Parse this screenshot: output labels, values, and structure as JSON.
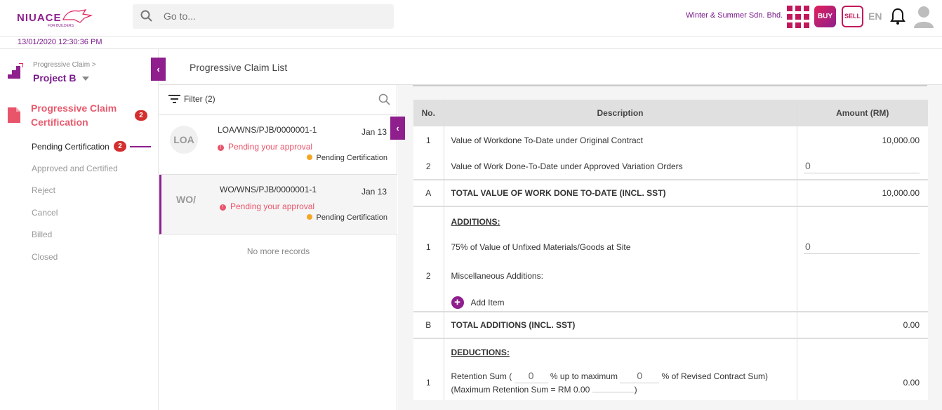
{
  "header": {
    "logo_text": "NIUACE",
    "logo_sub": "FOR BUILDERS",
    "search_placeholder": "Go to...",
    "company": "Winter & Summer Sdn. Bhd.",
    "buy_label": "BUY",
    "sell_label": "SELL",
    "language": "EN",
    "datetime": "13/01/2020 12:30:36 PM"
  },
  "sidebar": {
    "breadcrumb": "Progressive Claim >",
    "project": "Project B",
    "section_title": "Progressive Claim Certification",
    "section_count": "2",
    "items": [
      {
        "label": "Pending Certification",
        "count": "2"
      },
      {
        "label": "Approved and Certified"
      },
      {
        "label": "Reject"
      },
      {
        "label": "Cancel"
      },
      {
        "label": "Billed"
      },
      {
        "label": "Closed"
      }
    ]
  },
  "list": {
    "title": "Progressive Claim List",
    "filter_label": "Filter (2)",
    "cards": [
      {
        "avatar": "LOA",
        "ref": "LOA/WNS/PJB/0000001-1",
        "date": "Jan 13",
        "pending": "Pending your approval",
        "status": "Pending Certification"
      },
      {
        "avatar": "WO/",
        "ref": "WO/WNS/PJB/0000001-1",
        "date": "Jan 13",
        "pending": "Pending your approval",
        "status": "Pending Certification"
      }
    ],
    "no_more": "No more records"
  },
  "claim_table": {
    "headers": {
      "no": "No.",
      "description": "Description",
      "amount": "Amount (RM)"
    },
    "rows": {
      "r1_no": "1",
      "r1_desc": "Value of Workdone To-Date under Original Contract",
      "r1_amt": "10,000.00",
      "r2_no": "2",
      "r2_desc": "Value of Work Done-To-Date under Approved Variation Orders",
      "r2_amt": "0",
      "rA_no": "A",
      "rA_desc": "TOTAL VALUE OF WORK DONE TO-DATE (INCL. SST)",
      "rA_amt": "10,000.00",
      "additions_title": "ADDITIONS:",
      "ad1_no": "1",
      "ad1_desc": "75% of Value of Unfixed Materials/Goods at Site",
      "ad1_amt": "0",
      "ad2_no": "2",
      "ad2_desc": "Miscellaneous Additions:",
      "add_item": "Add Item",
      "rB_no": "B",
      "rB_desc": "TOTAL ADDITIONS (INCL. SST)",
      "rB_amt": "0.00",
      "deductions_title": "DEDUCTIONS:",
      "de1_no": "1",
      "de1_pre": "Retention Sum (",
      "de1_pct": "0",
      "de1_mid": "% up to maximum",
      "de1_max": "0",
      "de1_post": "% of Revised Contract Sum)",
      "de1_line2": "(Maximum Retention Sum = RM 0.00",
      "de1_line2_end": ")",
      "de1_amt": "0.00"
    }
  },
  "colors": {
    "brand": "#8e1f8d",
    "accent": "#c2185b",
    "danger": "#e8546a",
    "warning": "#f5a623"
  }
}
